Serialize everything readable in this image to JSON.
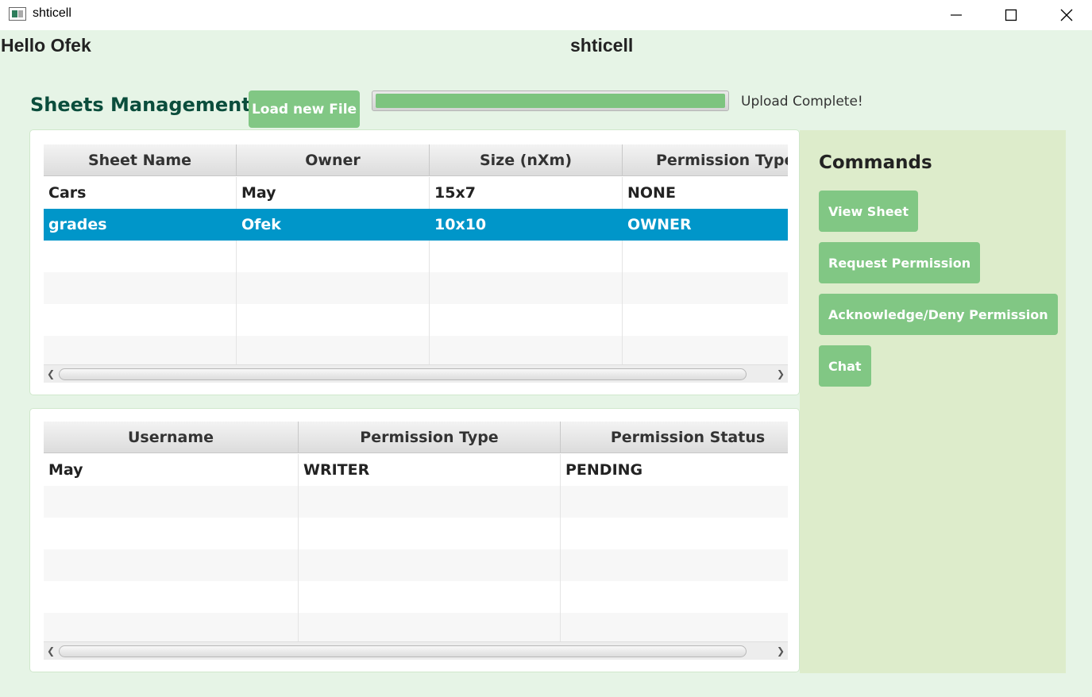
{
  "window": {
    "title": "shticell"
  },
  "header": {
    "greeting": "Hello Ofek",
    "app_name": "shticell"
  },
  "sheets_management": {
    "title": "Sheets Management",
    "load_button": "Load new File",
    "upload_progress": 1.0,
    "upload_status": "Upload Complete!"
  },
  "sheets_table": {
    "columns": [
      "Sheet Name",
      "Owner",
      "Size (nXm)",
      "Permission Type"
    ],
    "rows": [
      [
        "Cars",
        "May",
        "15x7",
        "NONE"
      ],
      [
        "grades",
        "Ofek",
        "10x10",
        "OWNER"
      ]
    ],
    "selected_row": 1
  },
  "permissions_table": {
    "columns": [
      "Username",
      "Permission Type",
      "Permission Status"
    ],
    "rows": [
      [
        "May",
        "WRITER",
        "PENDING"
      ]
    ]
  },
  "commands": {
    "title": "Commands",
    "buttons": [
      "View Sheet",
      "Request Permission",
      "Acknowledge/Deny Permission",
      "Chat"
    ]
  },
  "colors": {
    "accent_green": "#81c784",
    "selection_blue": "#0096c9",
    "section_title": "#0b4d3c",
    "background": "#e6f4e6",
    "commands_panel": "#ddeccb"
  },
  "icons": {
    "app": "app-icon",
    "minimize": "minimize-icon",
    "maximize": "maximize-icon",
    "close": "close-icon",
    "scroll_left": "chevron-left-icon",
    "scroll_right": "chevron-right-icon"
  }
}
